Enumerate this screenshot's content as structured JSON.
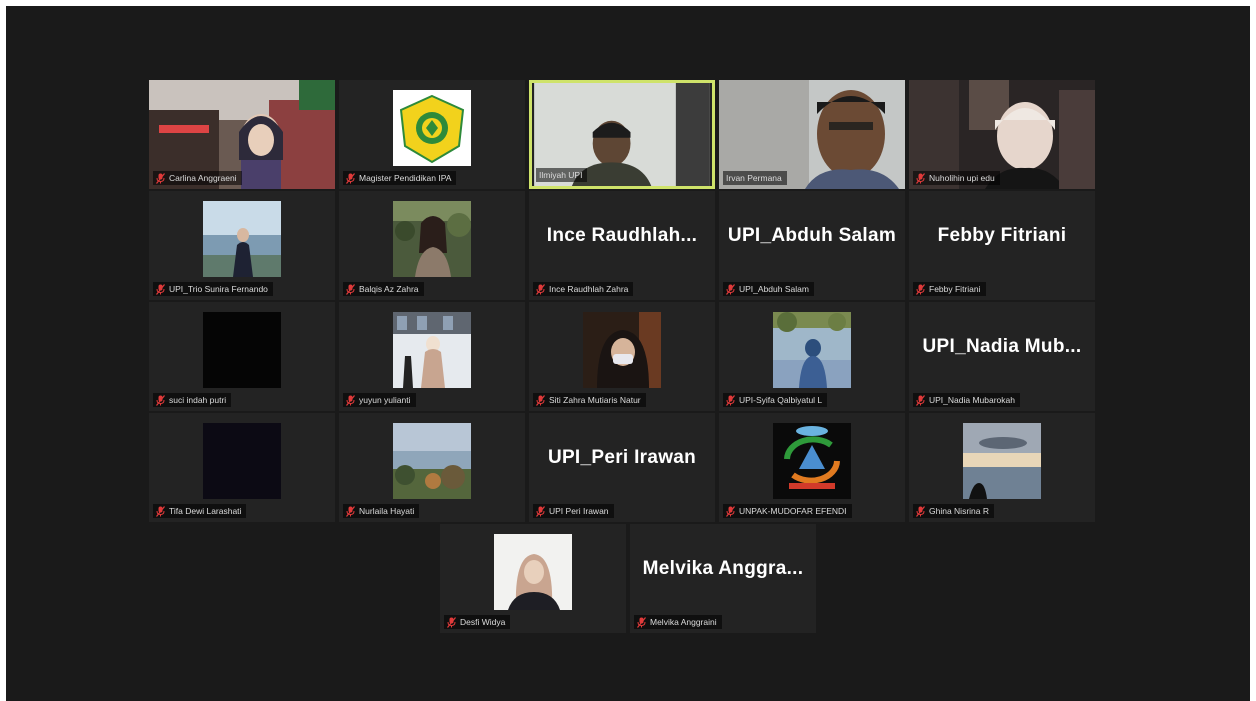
{
  "app": {
    "accent_active": "#cfe36a",
    "mic_muted_color": "#e03a3a"
  },
  "rows": [
    [
      {
        "name": "Carlina Anggraeni",
        "type": "video",
        "photo": "street-selfie"
      },
      {
        "name": "Magister Pendidikan IPA",
        "type": "photo",
        "photo": "logo-badge"
      },
      {
        "name": "Ilmiyah UPI",
        "type": "video",
        "photo": "webcam-man",
        "active": true,
        "muted": false
      },
      {
        "name": "Irvan Permana",
        "type": "video",
        "photo": "webcam-man-close",
        "muted": false
      },
      {
        "name": "Nuholihin upi edu",
        "type": "video",
        "photo": "webcam-woman"
      }
    ],
    [
      {
        "name": "UPI_Trio Sunira Fernando",
        "type": "photo",
        "photo": "beach-girl"
      },
      {
        "name": "Balqis Az Zahra",
        "type": "photo",
        "photo": "girl-garden"
      },
      {
        "name": "Ince Raudhlah Zahra",
        "type": "text",
        "big": "Ince  Raudhlah..."
      },
      {
        "name": "UPI_Abduh Salam",
        "type": "text",
        "big": "UPI_Abduh Salam"
      },
      {
        "name": "Febby Fitriani",
        "type": "text",
        "big": "Febby Fitriani"
      }
    ],
    [
      {
        "name": "suci indah putri",
        "type": "photo",
        "photo": "black"
      },
      {
        "name": "yuyun yulianti",
        "type": "photo",
        "photo": "snow-girl"
      },
      {
        "name": "Siti Zahra Mutiaris Natur",
        "type": "photo",
        "photo": "hijab-mask"
      },
      {
        "name": "UPI-Syifa Qalbiyatul L",
        "type": "photo",
        "photo": "blue-park"
      },
      {
        "name": "UPI_Nadia Mubarokah",
        "type": "text",
        "big": "UPI_Nadia  Mub..."
      }
    ],
    [
      {
        "name": "Tifa Dewi Larashati",
        "type": "photo",
        "photo": "black-purple"
      },
      {
        "name": "Nurlaila Hayati",
        "type": "photo",
        "photo": "sea-trees"
      },
      {
        "name": "UPI Peri Irawan",
        "type": "text",
        "big": "UPI_Peri Irawan"
      },
      {
        "name": "UNPAK-MUDOFAR EFENDI",
        "type": "photo",
        "photo": "recycle-logo"
      },
      {
        "name": "Ghina Nisrina R",
        "type": "photo",
        "photo": "sunset-sea"
      }
    ],
    [
      {
        "name": "Desfi Widya",
        "type": "photo",
        "photo": "hijab-woman"
      },
      {
        "name": "Melvika Anggraini",
        "type": "text",
        "big": "Melvika  Anggra..."
      }
    ]
  ]
}
